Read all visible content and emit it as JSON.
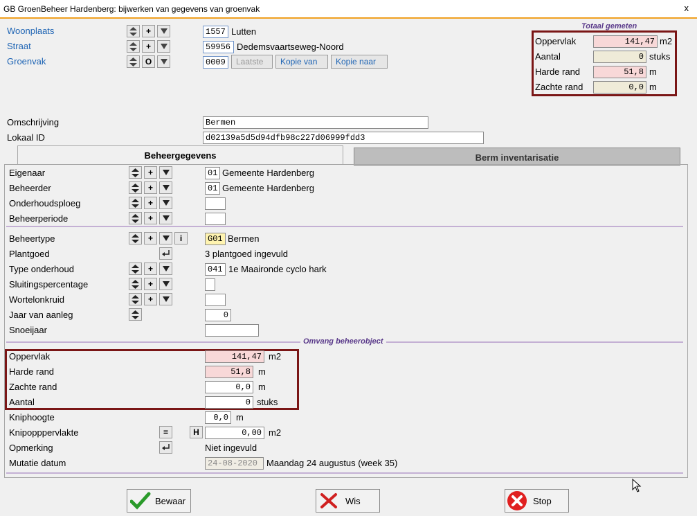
{
  "window": {
    "title": "GB GroenBeheer Hardenberg: bijwerken van gegevens van groenvak",
    "close": "x"
  },
  "header": {
    "woonplaats": {
      "label": "Woonplaats",
      "code": "1557",
      "value": "Lutten"
    },
    "straat": {
      "label": "Straat",
      "code": "59956",
      "value": "Dedemsvaartseweg-Noord"
    },
    "groenvak": {
      "label": "Groenvak",
      "code": "0009",
      "btn_laatste": "Laatste",
      "btn_kopie_van": "Kopie van",
      "btn_kopie_naar": "Kopie naar"
    }
  },
  "totaal": {
    "title": "Totaal gemeten",
    "rows": [
      {
        "label": "Oppervlak",
        "value": "141,47",
        "unit": "m2"
      },
      {
        "label": "Aantal",
        "value": "0",
        "unit": "stuks"
      },
      {
        "label": "Harde rand",
        "value": "51,8",
        "unit": "m"
      },
      {
        "label": "Zachte rand",
        "value": "0,0",
        "unit": "m"
      }
    ]
  },
  "omschrijving": {
    "label": "Omschrijving",
    "value": "Bermen"
  },
  "lokaal_id": {
    "label": "Lokaal ID",
    "value": "d02139a5d5d94dfb98c227d06999fdd3"
  },
  "tabs": [
    {
      "label": "Beheergegevens"
    },
    {
      "label": "Berm inventarisatie"
    }
  ],
  "beheer": {
    "eigenaar": {
      "label": "Eigenaar",
      "code": "01",
      "value": "Gemeente Hardenberg"
    },
    "beheerder": {
      "label": "Beheerder",
      "code": "01",
      "value": "Gemeente Hardenberg"
    },
    "onderhoudsploeg": {
      "label": "Onderhoudsploeg"
    },
    "beheerperiode": {
      "label": "Beheerperiode"
    },
    "beheertype": {
      "label": "Beheertype",
      "code": "G01",
      "value": "Bermen"
    },
    "plantgoed": {
      "label": "Plantgoed",
      "value": "3 plantgoed ingevuld"
    },
    "type_onderhoud": {
      "label": "Type onderhoud",
      "code": "041",
      "value": "1e Maaironde cyclo hark"
    },
    "sluitingspercentage": {
      "label": "Sluitingspercentage"
    },
    "wortelonkruid": {
      "label": "Wortelonkruid"
    },
    "jaar_van_aanleg": {
      "label": "Jaar van aanleg",
      "value": "0"
    },
    "snoeijaar": {
      "label": "Snoeijaar"
    }
  },
  "omvang": {
    "title": "Omvang beheerobject",
    "oppervlak": {
      "label": "Oppervlak",
      "value": "141,47",
      "unit": "m2"
    },
    "harde_rand": {
      "label": "Harde rand",
      "value": "51,8",
      "unit": "m"
    },
    "zachte_rand": {
      "label": "Zachte rand",
      "value": "0,0",
      "unit": "m"
    },
    "aantal": {
      "label": "Aantal",
      "value": "0",
      "unit": "stuks"
    }
  },
  "extra": {
    "kniphoogte": {
      "label": "Kniphoogte",
      "value": "0,0",
      "unit": "m"
    },
    "knipoppervlakte": {
      "label": "Knipopppervlakte",
      "btn_eq": "=",
      "btn_h": "H",
      "value": "0,00",
      "unit": "m2"
    },
    "opmerking": {
      "label": "Opmerking",
      "value": "Niet ingevuld"
    },
    "mutatie_datum": {
      "label": "Mutatie datum",
      "value": "24-08-2020",
      "text": "Maandag 24 augustus (week 35)"
    }
  },
  "footer": {
    "bewaar": "Bewaar",
    "wis": "Wis",
    "stop": "Stop"
  },
  "colors": {
    "accent_link": "#1e64b4",
    "group_border": "#7a1616",
    "title_underline": "#f0a020",
    "highlight_pink": "#f8d8d8"
  }
}
